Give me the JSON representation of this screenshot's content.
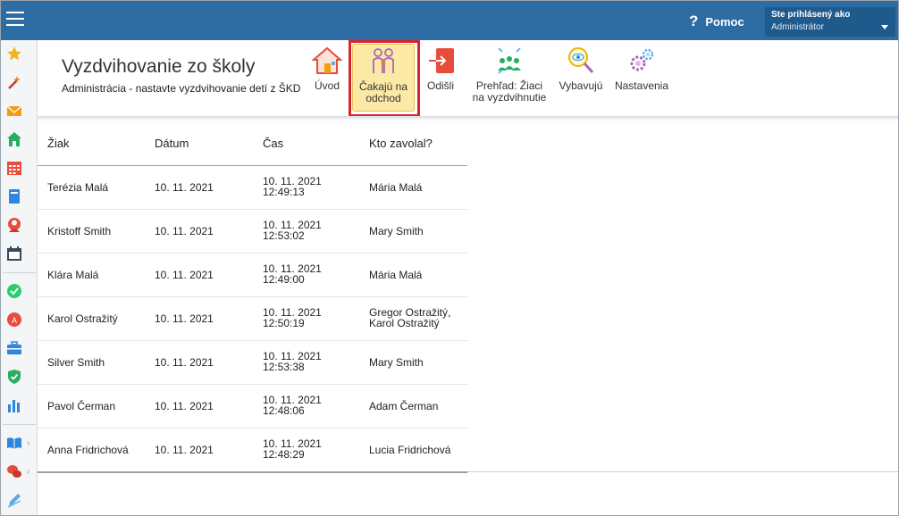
{
  "header": {
    "help_label": "Pomoc",
    "help_icon": "?",
    "user_label": "Ste prihlásený ako",
    "user_role": "Administrátor"
  },
  "page": {
    "title": "Vyzdvihovanie zo školy",
    "subtitle": "Administrácia - nastavte vyzdvihovanie detí z ŠKD"
  },
  "toolbar": [
    {
      "id": "uvod",
      "line1": "Úvod",
      "line2": "",
      "icon": "house-icon"
    },
    {
      "id": "cakaju",
      "line1": "Čakajú na",
      "line2": "odchod",
      "icon": "family-icon",
      "active": true
    },
    {
      "id": "odisli",
      "line1": "Odišli",
      "line2": "",
      "icon": "exit-icon"
    },
    {
      "id": "prehlad",
      "line1": "Prehľad: Žiaci",
      "line2": "na vyzdvihnutie",
      "icon": "group-overview-icon"
    },
    {
      "id": "vybavuju",
      "line1": "Vybavujú",
      "line2": "",
      "icon": "magnifier-eye-icon"
    },
    {
      "id": "nastavenia",
      "line1": "Nastavenia",
      "line2": "",
      "icon": "gears-icon"
    }
  ],
  "table": {
    "columns": [
      "Žiak",
      "Dátum",
      "Čas",
      "Kto zavolal?"
    ],
    "rows": [
      {
        "student": "Terézia Malá",
        "date": "10. 11. 2021",
        "time1": "10. 11. 2021",
        "time2": "12:49:13",
        "caller1": "Mária Malá",
        "caller2": ""
      },
      {
        "student": "Kristoff Smith",
        "date": "10. 11. 2021",
        "time1": "10. 11. 2021",
        "time2": "12:53:02",
        "caller1": "Mary Smith",
        "caller2": ""
      },
      {
        "student": "Klára Malá",
        "date": "10. 11. 2021",
        "time1": "10. 11. 2021",
        "time2": "12:49:00",
        "caller1": "Mária Malá",
        "caller2": ""
      },
      {
        "student": "Karol Ostražitý",
        "date": "10. 11. 2021",
        "time1": "10. 11. 2021",
        "time2": "12:50:19",
        "caller1": "Gregor Ostražitý,",
        "caller2": "Karol Ostražitý"
      },
      {
        "student": "Silver Smith",
        "date": "10. 11. 2021",
        "time1": "10. 11. 2021",
        "time2": "12:53:38",
        "caller1": "Mary Smith",
        "caller2": ""
      },
      {
        "student": "Pavol Čerman",
        "date": "10. 11. 2021",
        "time1": "10. 11. 2021",
        "time2": "12:48:06",
        "caller1": "Adam Čerman",
        "caller2": ""
      },
      {
        "student": "Anna Fridrichová",
        "date": "10. 11. 2021",
        "time1": "10. 11. 2021",
        "time2": "12:48:29",
        "caller1": "Lucia Fridrichová",
        "caller2": ""
      }
    ]
  },
  "sidebar": {
    "icons": [
      "star-icon",
      "magic-wand-icon",
      "envelope-icon",
      "home-icon",
      "calendar-grid-icon",
      "notebook-icon",
      "user-badge-icon",
      "calendar-icon",
      "check-circle-icon",
      "grade-icon",
      "briefcase-icon",
      "shield-check-icon",
      "bar-chart-icon",
      "book-open-icon",
      "chat-bubbles-icon",
      "pencil-icon"
    ]
  }
}
